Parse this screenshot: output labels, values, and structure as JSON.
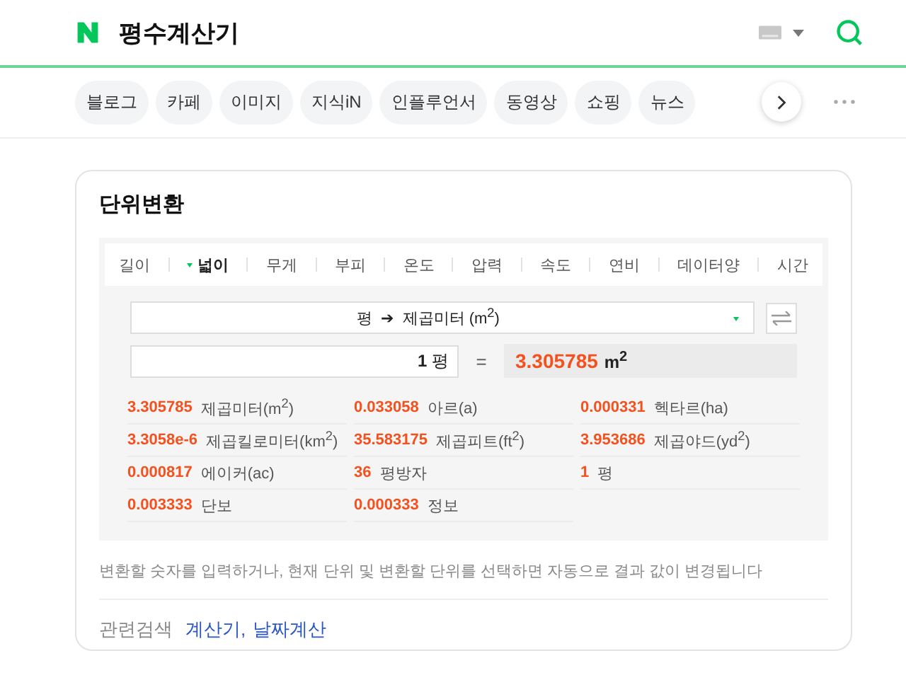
{
  "header": {
    "query": "평수계산기"
  },
  "chips": [
    "블로그",
    "카페",
    "이미지",
    "지식iN",
    "인플루언서",
    "동영상",
    "쇼핑",
    "뉴스"
  ],
  "card": {
    "title": "단위변환",
    "tabs": [
      {
        "label": "길이",
        "selected": false
      },
      {
        "label": "넓이",
        "selected": true
      },
      {
        "label": "무게",
        "selected": false
      },
      {
        "label": "부피",
        "selected": false
      },
      {
        "label": "온도",
        "selected": false
      },
      {
        "label": "압력",
        "selected": false
      },
      {
        "label": "속도",
        "selected": false
      },
      {
        "label": "연비",
        "selected": false
      },
      {
        "label": "데이터양",
        "selected": false
      },
      {
        "label": "시간",
        "selected": false
      }
    ],
    "unit_select": {
      "from": "평",
      "arrow": "➔",
      "to": "제곱미터 (m$^{2}$)"
    },
    "input": {
      "value": "1",
      "unit": "평"
    },
    "equals": "=",
    "result": {
      "value": "3.305785",
      "unit": "m$^{2}$"
    },
    "results": [
      {
        "value": "3.305785",
        "unit": "제곱미터(m$^{2}$)"
      },
      {
        "value": "0.033058",
        "unit": "아르(a)"
      },
      {
        "value": "0.000331",
        "unit": "헥타르(ha)"
      },
      {
        "value": "3.3058e-6",
        "unit": "제곱킬로미터(km$^{2}$)"
      },
      {
        "value": "35.583175",
        "unit": "제곱피트(ft$^{2}$)"
      },
      {
        "value": "3.953686",
        "unit": "제곱야드(yd$^{2}$)"
      },
      {
        "value": "0.000817",
        "unit": "에이커(ac)"
      },
      {
        "value": "36",
        "unit": "평방자"
      },
      {
        "value": "1",
        "unit": "평"
      },
      {
        "value": "0.003333",
        "unit": "단보"
      },
      {
        "value": "0.000333",
        "unit": "정보"
      }
    ],
    "note": "변환할 숫자를 입력하거나, 현재 단위 및 변환할 단위를 선택하면 자동으로 결과 값이 변경됩니다",
    "related": {
      "label": "관련검색",
      "links": [
        "계산기,",
        "날짜계산"
      ]
    }
  }
}
